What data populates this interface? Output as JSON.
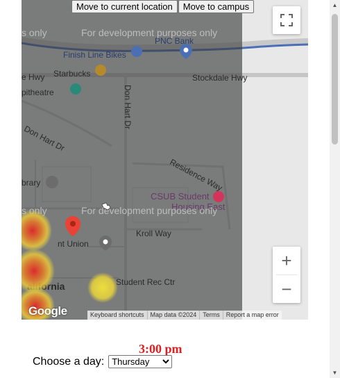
{
  "controls": {
    "move_current_label": "Move to current location",
    "move_campus_label": "Move to campus"
  },
  "map": {
    "watermark": "For development purposes only",
    "watermark_left_fragment": "s only",
    "labels": {
      "bank": "PNC Bank",
      "finishline": "Finish Line Bikes",
      "starbucks": "Starbucks",
      "hwy_left": "e Hwy",
      "stockdale": "Stockdale Hwy",
      "theatre": "pitheatre",
      "donhart_vert": "Don Hart Dr",
      "donhart_diag": "Don Hart Dr",
      "residence": "Residence Way",
      "library": "brary",
      "csub": "CSUB Student",
      "csub2": "Housing East",
      "kroll": "Kroll Way",
      "union": "nt Union",
      "rec": "Student Rec Ctr",
      "california": "alifornia"
    },
    "zoom_in": "+",
    "zoom_out": "−",
    "google": "Google",
    "attribution": [
      "Keyboard shortcuts",
      "Map data ©2024",
      "Terms",
      "Report a map error"
    ]
  },
  "time_display": "3:00 pm",
  "day_picker": {
    "label": "Choose a day:",
    "selected": "Thursday"
  },
  "colors": {
    "time_red": "#e02020",
    "heat_red": "#e0262a",
    "heat_yellow": "#f3e43b"
  }
}
